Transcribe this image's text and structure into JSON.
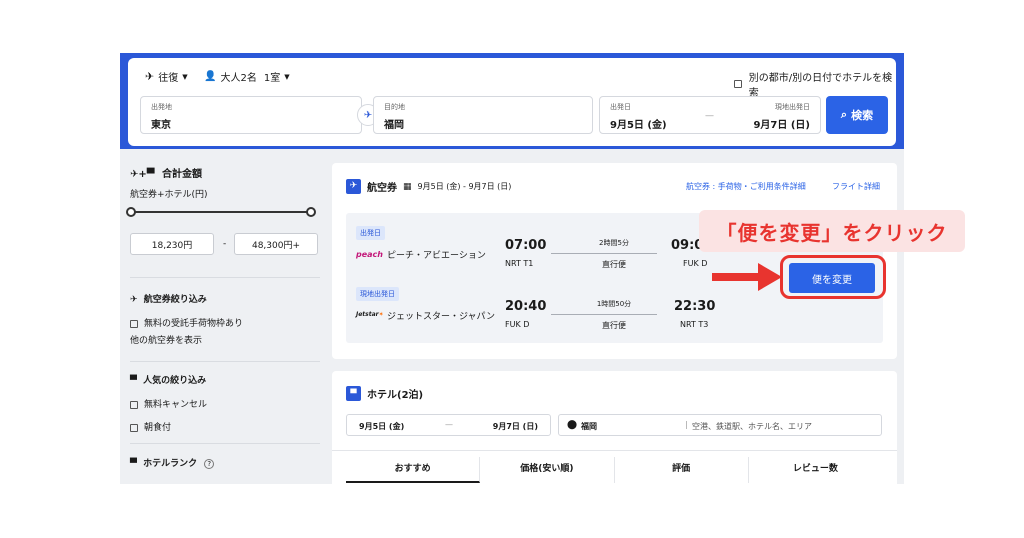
{
  "topbar": {
    "trip_type": "往復",
    "travelers": "大人2名",
    "rooms": "1室",
    "other_city_label": "別の都市/別の日付でホテルを検索"
  },
  "search": {
    "origin_label": "出発地",
    "origin_value": "東京",
    "dest_label": "目的地",
    "dest_value": "福岡",
    "depart_label": "出発日",
    "depart_value": "9月5日 (金)",
    "dash": "—",
    "return_label": "現地出発日",
    "return_value": "9月7日 (日)",
    "button_label": "検索"
  },
  "sidebar": {
    "total_title": "合計金額",
    "price_subtitle": "航空券+ホテル(円)",
    "price_min": "18,230円",
    "price_sep": "-",
    "price_max": "48,300円+",
    "flight_filter_title": "航空券絞り込み",
    "free_baggage": "無料の受託手荷物枠あり",
    "more_flights_link": "他の航空券を表示",
    "popular_title": "人気の絞り込み",
    "free_cancel": "無料キャンセル",
    "breakfast": "朝食付",
    "hotel_rank_title": "ホテルランク"
  },
  "flight": {
    "title": "航空券",
    "dates": "9月5日 (金) - 9月7日 (日)",
    "terms_link": "航空券 : 手荷物・ご利用条件詳細",
    "details_link": "フライト詳細",
    "outbound_tag": "出発日",
    "outbound_logo": "peach",
    "outbound_airline": "ピーチ・アビエーション",
    "outbound_dep_time": "07:00",
    "outbound_dep_airport": "NRT T1",
    "outbound_duration": "2時間5分",
    "outbound_stops": "直行便",
    "outbound_arr_time": "09:0",
    "outbound_arr_airport": "FUK D",
    "return_tag": "現地出発日",
    "return_logo": "Jetstar",
    "return_airline": "ジェットスター・ジャパン",
    "return_dep_time": "20:40",
    "return_dep_airport": "FUK D",
    "return_duration": "1時間50分",
    "return_stops": "直行便",
    "return_arr_time": "22:30",
    "return_arr_airport": "NRT T3",
    "change_button": "便を変更"
  },
  "hotel": {
    "title": "ホテル(2泊)",
    "checkin": "9月5日 (金)",
    "dash": "—",
    "checkout": "9月7日 (日)",
    "location": "福岡",
    "location_placeholder": "空港、鉄道駅、ホテル名、エリア",
    "tabs": [
      "おすすめ",
      "価格(安い順)",
      "評価",
      "レビュー数"
    ]
  },
  "annotation": {
    "callout": "「便を変更」をクリック"
  },
  "colors": {
    "brand_blue": "#2b58d8",
    "button_blue": "#2b63e6",
    "annotation_red": "#e8342f"
  }
}
